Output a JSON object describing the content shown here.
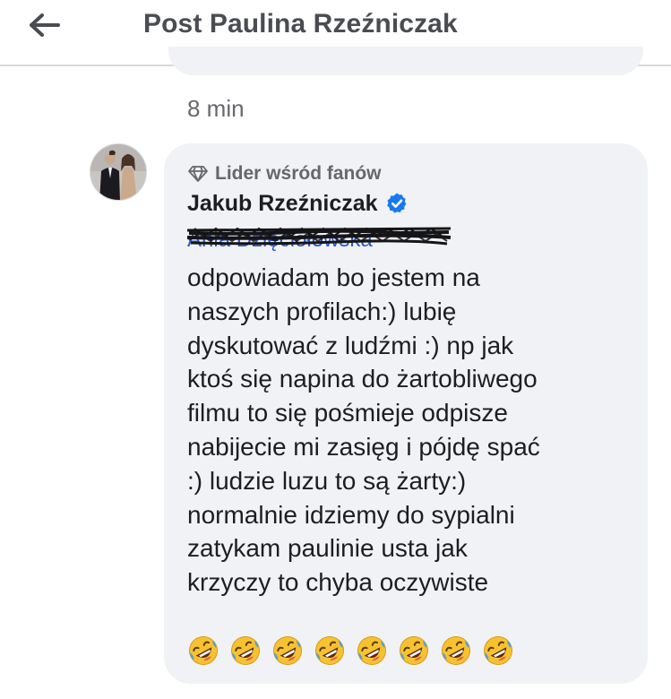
{
  "header": {
    "title": "Post Paulina Rzeźniczak",
    "back_icon": "arrow-left-icon"
  },
  "previous_comment": {
    "timestamp": "8 min"
  },
  "comment": {
    "badge": {
      "icon": "diamond-icon",
      "label": "Lider wśród fanów"
    },
    "author": "Jakub Rzeźniczak",
    "verified_icon": "verified-badge-icon",
    "mention": "Ania Dzięciołowska",
    "lines": [
      "odpowiadam bo jestem na",
      "naszych profilach:) lubię",
      "dyskutować z ludźmi :) np jak",
      "ktoś się napina do żartobliwego",
      "filmu to się pośmieje odpisze",
      "nabijecie mi zasięg i pójdę spać",
      ":) ludzie luzu to są żarty:)",
      "normalnie idziemy do sypialni",
      "zatykam paulinie usta jak",
      "krzyczy to chyba oczywiste"
    ],
    "emoji": "rolling-on-the-floor-laughing-emoji",
    "emoji_count": 8
  },
  "colors": {
    "bubble": "#f0f2f5",
    "verified": "#1877f2",
    "mention": "#2a57d0",
    "header_text": "#4a4c51",
    "meta_text": "#65676b"
  }
}
